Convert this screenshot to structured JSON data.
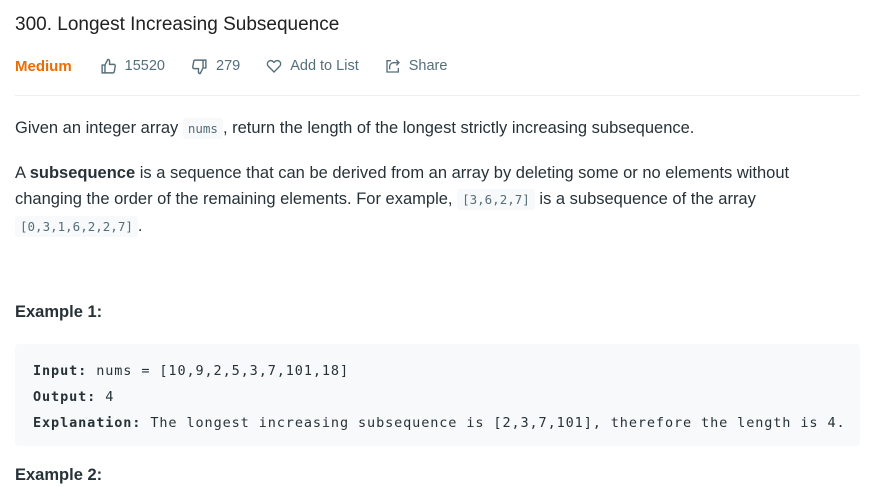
{
  "problem": {
    "title": "300. Longest Increasing Subsequence",
    "difficulty": "Medium",
    "likes": "15520",
    "dislikes": "279",
    "add_to_list": "Add to List",
    "share": "Share"
  },
  "colors": {
    "difficulty": "#ef6c00",
    "icon": "#546e7a"
  },
  "description": {
    "p1_before": "Given an integer array ",
    "p1_code": "nums",
    "p1_after": ", return the length of the longest strictly increasing subsequence.",
    "p2_start": "A ",
    "p2_bold": "subsequence",
    "p2_mid": " is a sequence that can be derived from an array by deleting some or no elements without changing the order of the remaining elements. For example, ",
    "p2_code1": "[3,6,2,7]",
    "p2_mid2": " is a subsequence of the array ",
    "p2_code2": "[0,3,1,6,2,2,7]",
    "p2_end": "."
  },
  "examples": [
    {
      "heading": "Example 1:",
      "input_label": "Input:",
      "input": " nums = [10,9,2,5,3,7,101,18]",
      "output_label": "Output:",
      "output": " 4",
      "explanation_label": "Explanation:",
      "explanation": " The longest increasing subsequence is [2,3,7,101], therefore the length is 4."
    },
    {
      "heading": "Example 2:"
    }
  ]
}
